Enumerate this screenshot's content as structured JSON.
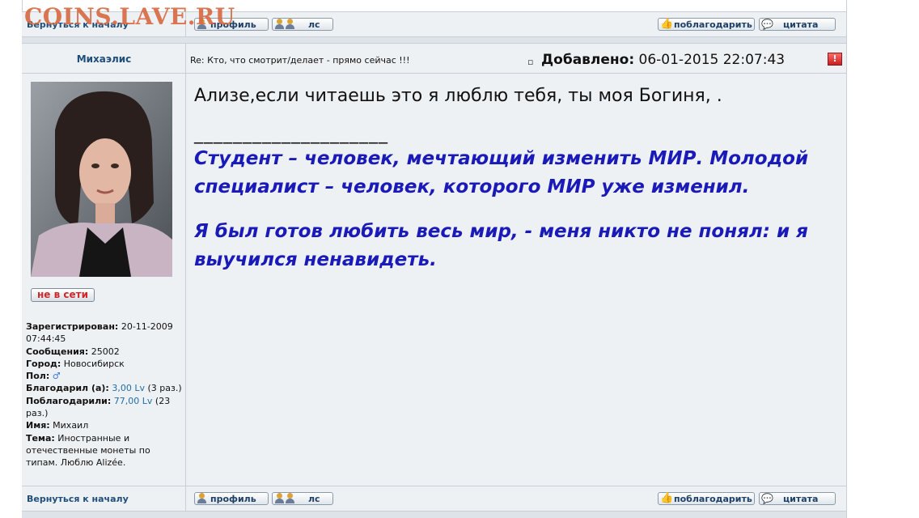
{
  "watermark": "COINS.LAVE.RU",
  "top_bar": {
    "back_link": "Вернуться к началу",
    "profile_btn": "профиль",
    "pm_btn": "лс",
    "thank_btn": "поблагодарить",
    "quote_btn": "цитата"
  },
  "post": {
    "author": "Михаэлис",
    "subject": "Re: Кто, что смотрит/делает - прямо сейчас !!!",
    "added_label": "Добавлено:",
    "added_date": "06-01-2015 22:07:43",
    "report_icon": "!",
    "status": "не в сети",
    "body_line": "Ализе,если читаешь это я люблю тебя, ты моя Богиня, .",
    "signature_rule": "____________________",
    "quote1": "Студент – человек, мечтающий изменить МИР. Молодой специалист – человек, которого МИР уже изменил.",
    "quote2": "Я был готов любить весь мир, - меня никто не понял: и я выучился ненавидеть."
  },
  "profile": {
    "registered_label": "Зарегистрирован:",
    "registered_value": "20-11-2009 07:44:45",
    "messages_label": "Сообщения:",
    "messages_value": "25002",
    "city_label": "Город:",
    "city_value": "Новосибирск",
    "gender_label": "Пол:",
    "gender_icon": "♂",
    "thanked_label": "Благодарил (а):",
    "thanked_value": "3,00 Lv",
    "thanked_count": "(3 раз.)",
    "got_thanks_label": "Поблагодарили:",
    "got_thanks_value": "77,00 Lv",
    "got_thanks_count": "(23 раз.)",
    "name_label": "Имя:",
    "name_value": "Михаил",
    "topic_label": "Тема:",
    "topic_value": "Иностранные и отечественные монеты по типам. Люблю Alizée."
  },
  "bottom_bar": {
    "back_link": "Вернуться к началу",
    "profile_btn": "профиль",
    "pm_btn": "лс",
    "thank_btn": "поблагодарить",
    "quote_btn": "цитата"
  },
  "colors": {
    "link": "#1e4e79",
    "quote_text": "#1a1ab8",
    "status_offline": "#d02828",
    "watermark": "#d96b44",
    "row_bg": "#eef1f4"
  },
  "icons": {
    "profile": "person-icon",
    "pm": "two-persons-icon",
    "thank": "thumbs-up-icon",
    "quote": "speech-bubble-icon",
    "post": "document-icon",
    "report": "exclamation-icon",
    "gender": "male-icon"
  }
}
